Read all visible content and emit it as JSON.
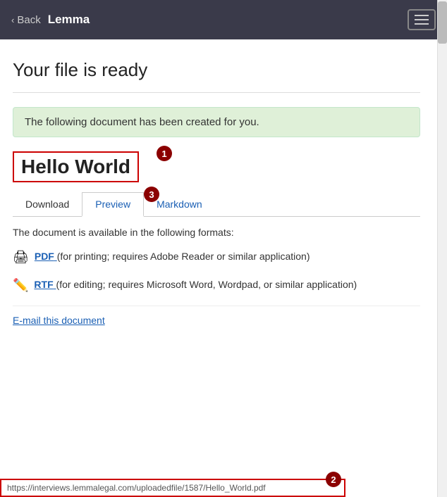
{
  "header": {
    "back_label": "Back",
    "title": "Lemma",
    "hamburger_aria": "Menu"
  },
  "main": {
    "page_title": "Your file is ready",
    "success_message": "The following document has been created for you.",
    "doc_title": "Hello World",
    "badge1": "1",
    "badge2": "2",
    "badge3": "3",
    "tabs": [
      {
        "label": "Download",
        "active": false
      },
      {
        "label": "Preview",
        "active": true
      },
      {
        "label": "Markdown",
        "active": false
      }
    ],
    "formats_intro": "The document is available in the following formats:",
    "formats": [
      {
        "icon": "🖨",
        "link_text": "PDF",
        "description": " (for printing; requires Adobe Reader or similar application)"
      },
      {
        "icon": "✏️",
        "link_text": "RTF",
        "description": " (for editing; requires Microsoft Word, Wordpad, or similar application)"
      }
    ],
    "email_label": "E-mail this document",
    "url_bar": "https://interviews.lemmalegal.com/uploadedfile/1587/Hello_World.pdf"
  }
}
